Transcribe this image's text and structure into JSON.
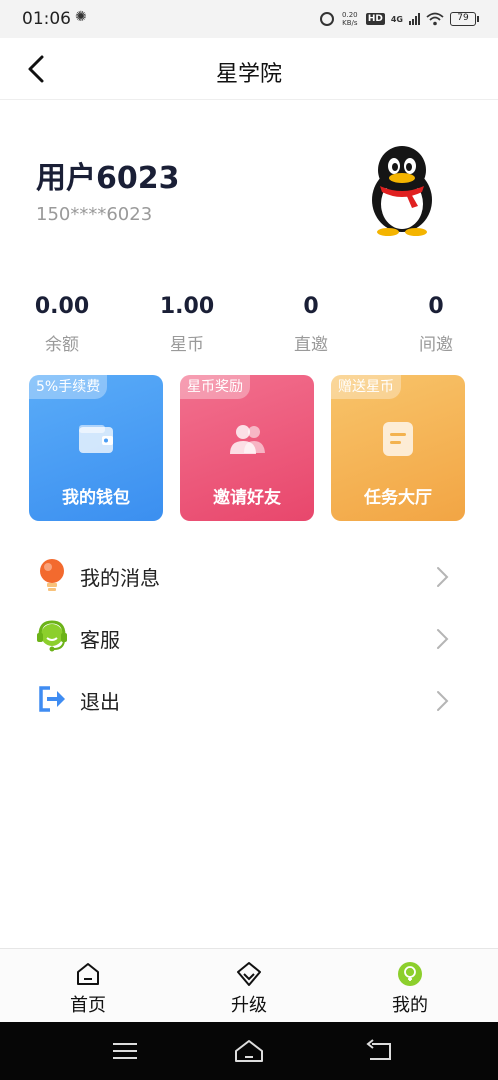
{
  "status_bar": {
    "time": "01:06",
    "speed_value": "0.20",
    "speed_unit": "KB/s",
    "hd_label": "HD",
    "network_label": "4G",
    "battery": "79"
  },
  "header": {
    "title": "星学院"
  },
  "profile": {
    "username": "用户6023",
    "phone": "150****6023"
  },
  "stats": [
    {
      "value": "0.00",
      "label": "余额"
    },
    {
      "value": "1.00",
      "label": "星币"
    },
    {
      "value": "0",
      "label": "直邀"
    },
    {
      "value": "0",
      "label": "间邀"
    }
  ],
  "cards": [
    {
      "badge": "5%手续费",
      "label": "我的钱包",
      "icon": "wallet-icon",
      "color_from": "#5aacf8",
      "color_to": "#3b8ff0"
    },
    {
      "badge": "星币奖励",
      "label": "邀请好友",
      "icon": "users-icon",
      "color_from": "#f2708e",
      "color_to": "#e8476c"
    },
    {
      "badge": "赠送星币",
      "label": "任务大厅",
      "icon": "document-icon",
      "color_from": "#f8c46a",
      "color_to": "#f2a544"
    }
  ],
  "menu": [
    {
      "label": "我的消息",
      "icon": "lightbulb-icon"
    },
    {
      "label": "客服",
      "icon": "headset-icon"
    },
    {
      "label": "退出",
      "icon": "logout-icon"
    }
  ],
  "tabs": [
    {
      "label": "首页",
      "icon": "home-icon"
    },
    {
      "label": "升级",
      "icon": "diamond-icon"
    },
    {
      "label": "我的",
      "icon": "profile-icon",
      "active": true
    }
  ],
  "colors": {
    "accent_green": "#8ccf2c",
    "text_dark": "#1a1f36",
    "text_muted": "#9a9a9a"
  }
}
